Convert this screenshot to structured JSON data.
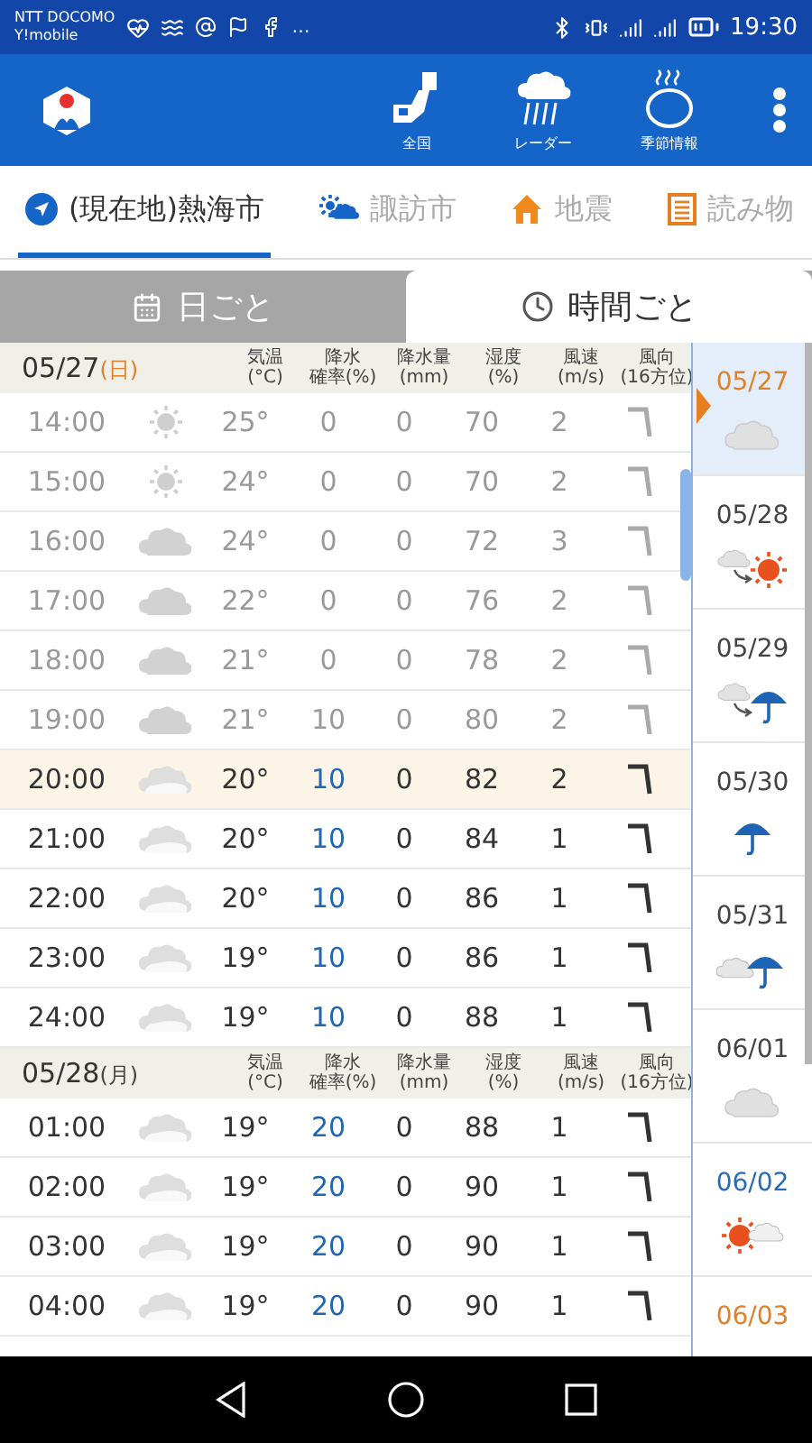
{
  "status_bar": {
    "carriers": [
      "NTT DOCOMO",
      "Y!mobile"
    ],
    "more": "…",
    "time": "19:30"
  },
  "app_bar": {
    "nav": [
      {
        "label": "全国",
        "kind": "map"
      },
      {
        "label": "レーダー",
        "kind": "radar"
      },
      {
        "label": "季節情報",
        "kind": "season"
      }
    ]
  },
  "location_tabs": [
    {
      "label": "(現在地)熱海市",
      "kind": "location",
      "selected": true
    },
    {
      "label": "諏訪市",
      "kind": "weather",
      "selected": false
    },
    {
      "label": "地震",
      "kind": "earthquake",
      "selected": false
    },
    {
      "label": "読み物",
      "kind": "reading",
      "selected": false
    }
  ],
  "view_tabs": [
    {
      "label": "日ごと",
      "kind": "calendar",
      "selected": false
    },
    {
      "label": "時間ごと",
      "kind": "clock",
      "selected": true
    }
  ],
  "days": [
    {
      "date": "05/27",
      "weekday": "(日)",
      "color": "#e0812b",
      "columns": [
        {
          "label": "気温",
          "unit": "(°C)"
        },
        {
          "label": "降水",
          "unit": "確率(%)"
        },
        {
          "label": "降水量",
          "unit": "(mm)"
        },
        {
          "label": "湿度",
          "unit": "(%)"
        },
        {
          "label": "風速",
          "unit": "(m/s)"
        },
        {
          "label": "風向",
          "unit": "(16方位)"
        }
      ],
      "rows": [
        {
          "time": "14:00",
          "kind": "sunny",
          "temp": "25°",
          "prob": "0",
          "amount": "0",
          "humidity": "70",
          "wind": "2",
          "past": true,
          "current": false
        },
        {
          "time": "15:00",
          "kind": "sunny",
          "temp": "24°",
          "prob": "0",
          "amount": "0",
          "humidity": "70",
          "wind": "2",
          "past": true,
          "current": false
        },
        {
          "time": "16:00",
          "kind": "cloudy",
          "temp": "24°",
          "prob": "0",
          "amount": "0",
          "humidity": "72",
          "wind": "3",
          "past": true,
          "current": false
        },
        {
          "time": "17:00",
          "kind": "cloudy",
          "temp": "22°",
          "prob": "0",
          "amount": "0",
          "humidity": "76",
          "wind": "2",
          "past": true,
          "current": false
        },
        {
          "time": "18:00",
          "kind": "cloudy",
          "temp": "21°",
          "prob": "0",
          "amount": "0",
          "humidity": "78",
          "wind": "2",
          "past": true,
          "current": false
        },
        {
          "time": "19:00",
          "kind": "cloudy",
          "temp": "21°",
          "prob": "10",
          "amount": "0",
          "humidity": "80",
          "wind": "2",
          "past": true,
          "current": false
        },
        {
          "time": "20:00",
          "kind": "cloudy",
          "temp": "20°",
          "prob": "10",
          "amount": "0",
          "humidity": "82",
          "wind": "2",
          "past": false,
          "current": true
        },
        {
          "time": "21:00",
          "kind": "cloudy",
          "temp": "20°",
          "prob": "10",
          "amount": "0",
          "humidity": "84",
          "wind": "1",
          "past": false,
          "current": false
        },
        {
          "time": "22:00",
          "kind": "cloudy",
          "temp": "20°",
          "prob": "10",
          "amount": "0",
          "humidity": "86",
          "wind": "1",
          "past": false,
          "current": false
        },
        {
          "time": "23:00",
          "kind": "cloudy",
          "temp": "19°",
          "prob": "10",
          "amount": "0",
          "humidity": "86",
          "wind": "1",
          "past": false,
          "current": false
        },
        {
          "time": "24:00",
          "kind": "cloudy",
          "temp": "19°",
          "prob": "10",
          "amount": "0",
          "humidity": "88",
          "wind": "1",
          "past": false,
          "current": false
        }
      ]
    },
    {
      "date": "05/28",
      "weekday": "(月)",
      "color": "#444444",
      "columns": [
        {
          "label": "気温",
          "unit": "(°C)"
        },
        {
          "label": "降水",
          "unit": "確率(%)"
        },
        {
          "label": "降水量",
          "unit": "(mm)"
        },
        {
          "label": "湿度",
          "unit": "(%)"
        },
        {
          "label": "風速",
          "unit": "(m/s)"
        },
        {
          "label": "風向",
          "unit": "(16方位)"
        }
      ],
      "rows": [
        {
          "time": "01:00",
          "kind": "cloudy",
          "temp": "19°",
          "prob": "20",
          "amount": "0",
          "humidity": "88",
          "wind": "1",
          "past": false,
          "current": false
        },
        {
          "time": "02:00",
          "kind": "cloudy",
          "temp": "19°",
          "prob": "20",
          "amount": "0",
          "humidity": "90",
          "wind": "1",
          "past": false,
          "current": false
        },
        {
          "time": "03:00",
          "kind": "cloudy",
          "temp": "19°",
          "prob": "20",
          "amount": "0",
          "humidity": "90",
          "wind": "1",
          "past": false,
          "current": false
        },
        {
          "time": "04:00",
          "kind": "cloudy",
          "temp": "19°",
          "prob": "20",
          "amount": "0",
          "humidity": "90",
          "wind": "1",
          "past": false,
          "current": false
        }
      ]
    }
  ],
  "date_list": [
    {
      "date": "05/27",
      "color": "#e0812b",
      "kind": "cloudy",
      "selected": true
    },
    {
      "date": "05/28",
      "color": "#444444",
      "kind": "cloudy-then-sunny",
      "selected": false
    },
    {
      "date": "05/29",
      "color": "#444444",
      "kind": "cloudy-then-rain",
      "selected": false
    },
    {
      "date": "05/30",
      "color": "#444444",
      "kind": "rain",
      "selected": false
    },
    {
      "date": "05/31",
      "color": "#444444",
      "kind": "cloudy-rain",
      "selected": false
    },
    {
      "date": "06/01",
      "color": "#444444",
      "kind": "cloudy",
      "selected": false
    },
    {
      "date": "06/02",
      "color": "#2a6bb8",
      "kind": "sunny-cloudy",
      "selected": false
    },
    {
      "date": "06/03",
      "color": "#e0812b",
      "selected": false
    }
  ]
}
